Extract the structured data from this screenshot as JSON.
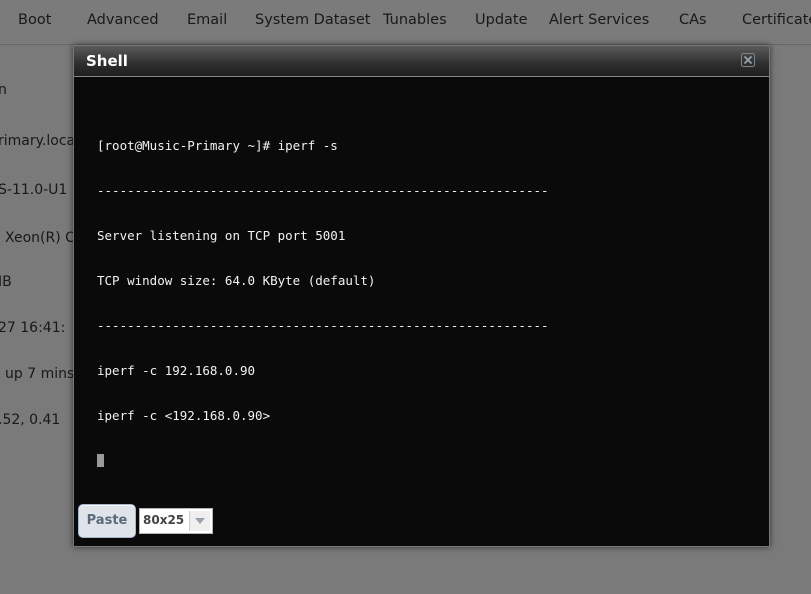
{
  "tabs": [
    {
      "label": "Boot"
    },
    {
      "label": "Advanced"
    },
    {
      "label": "Email"
    },
    {
      "label": "System Dataset"
    },
    {
      "label": "Tunables"
    },
    {
      "label": "Update"
    },
    {
      "label": "Alert Services"
    },
    {
      "label": "CAs"
    },
    {
      "label": "Certificate"
    }
  ],
  "background_info": [
    "n",
    "rimary.loca",
    "S-11.0-U1",
    "Xeon(R) C",
    "IB",
    "27 16:41:",
    "up 7 mins",
    ".52, 0.41"
  ],
  "dialog": {
    "title": "Shell",
    "close_icon": "close-icon",
    "terminal_lines": [
      "[root@Music-Primary ~]# iperf -s",
      "------------------------------------------------------------",
      "Server listening on TCP port 5001",
      "TCP window size: 64.0 KByte (default)",
      "------------------------------------------------------------",
      "iperf -c 192.168.0.90",
      "iperf -c <192.168.0.90>"
    ],
    "paste_label": "Paste",
    "terminal_size": "80x25"
  },
  "colors": {
    "terminal_bg": "#0a0a0a",
    "terminal_fg": "#f2f2f2",
    "titlebar": "#2e2e2e"
  }
}
